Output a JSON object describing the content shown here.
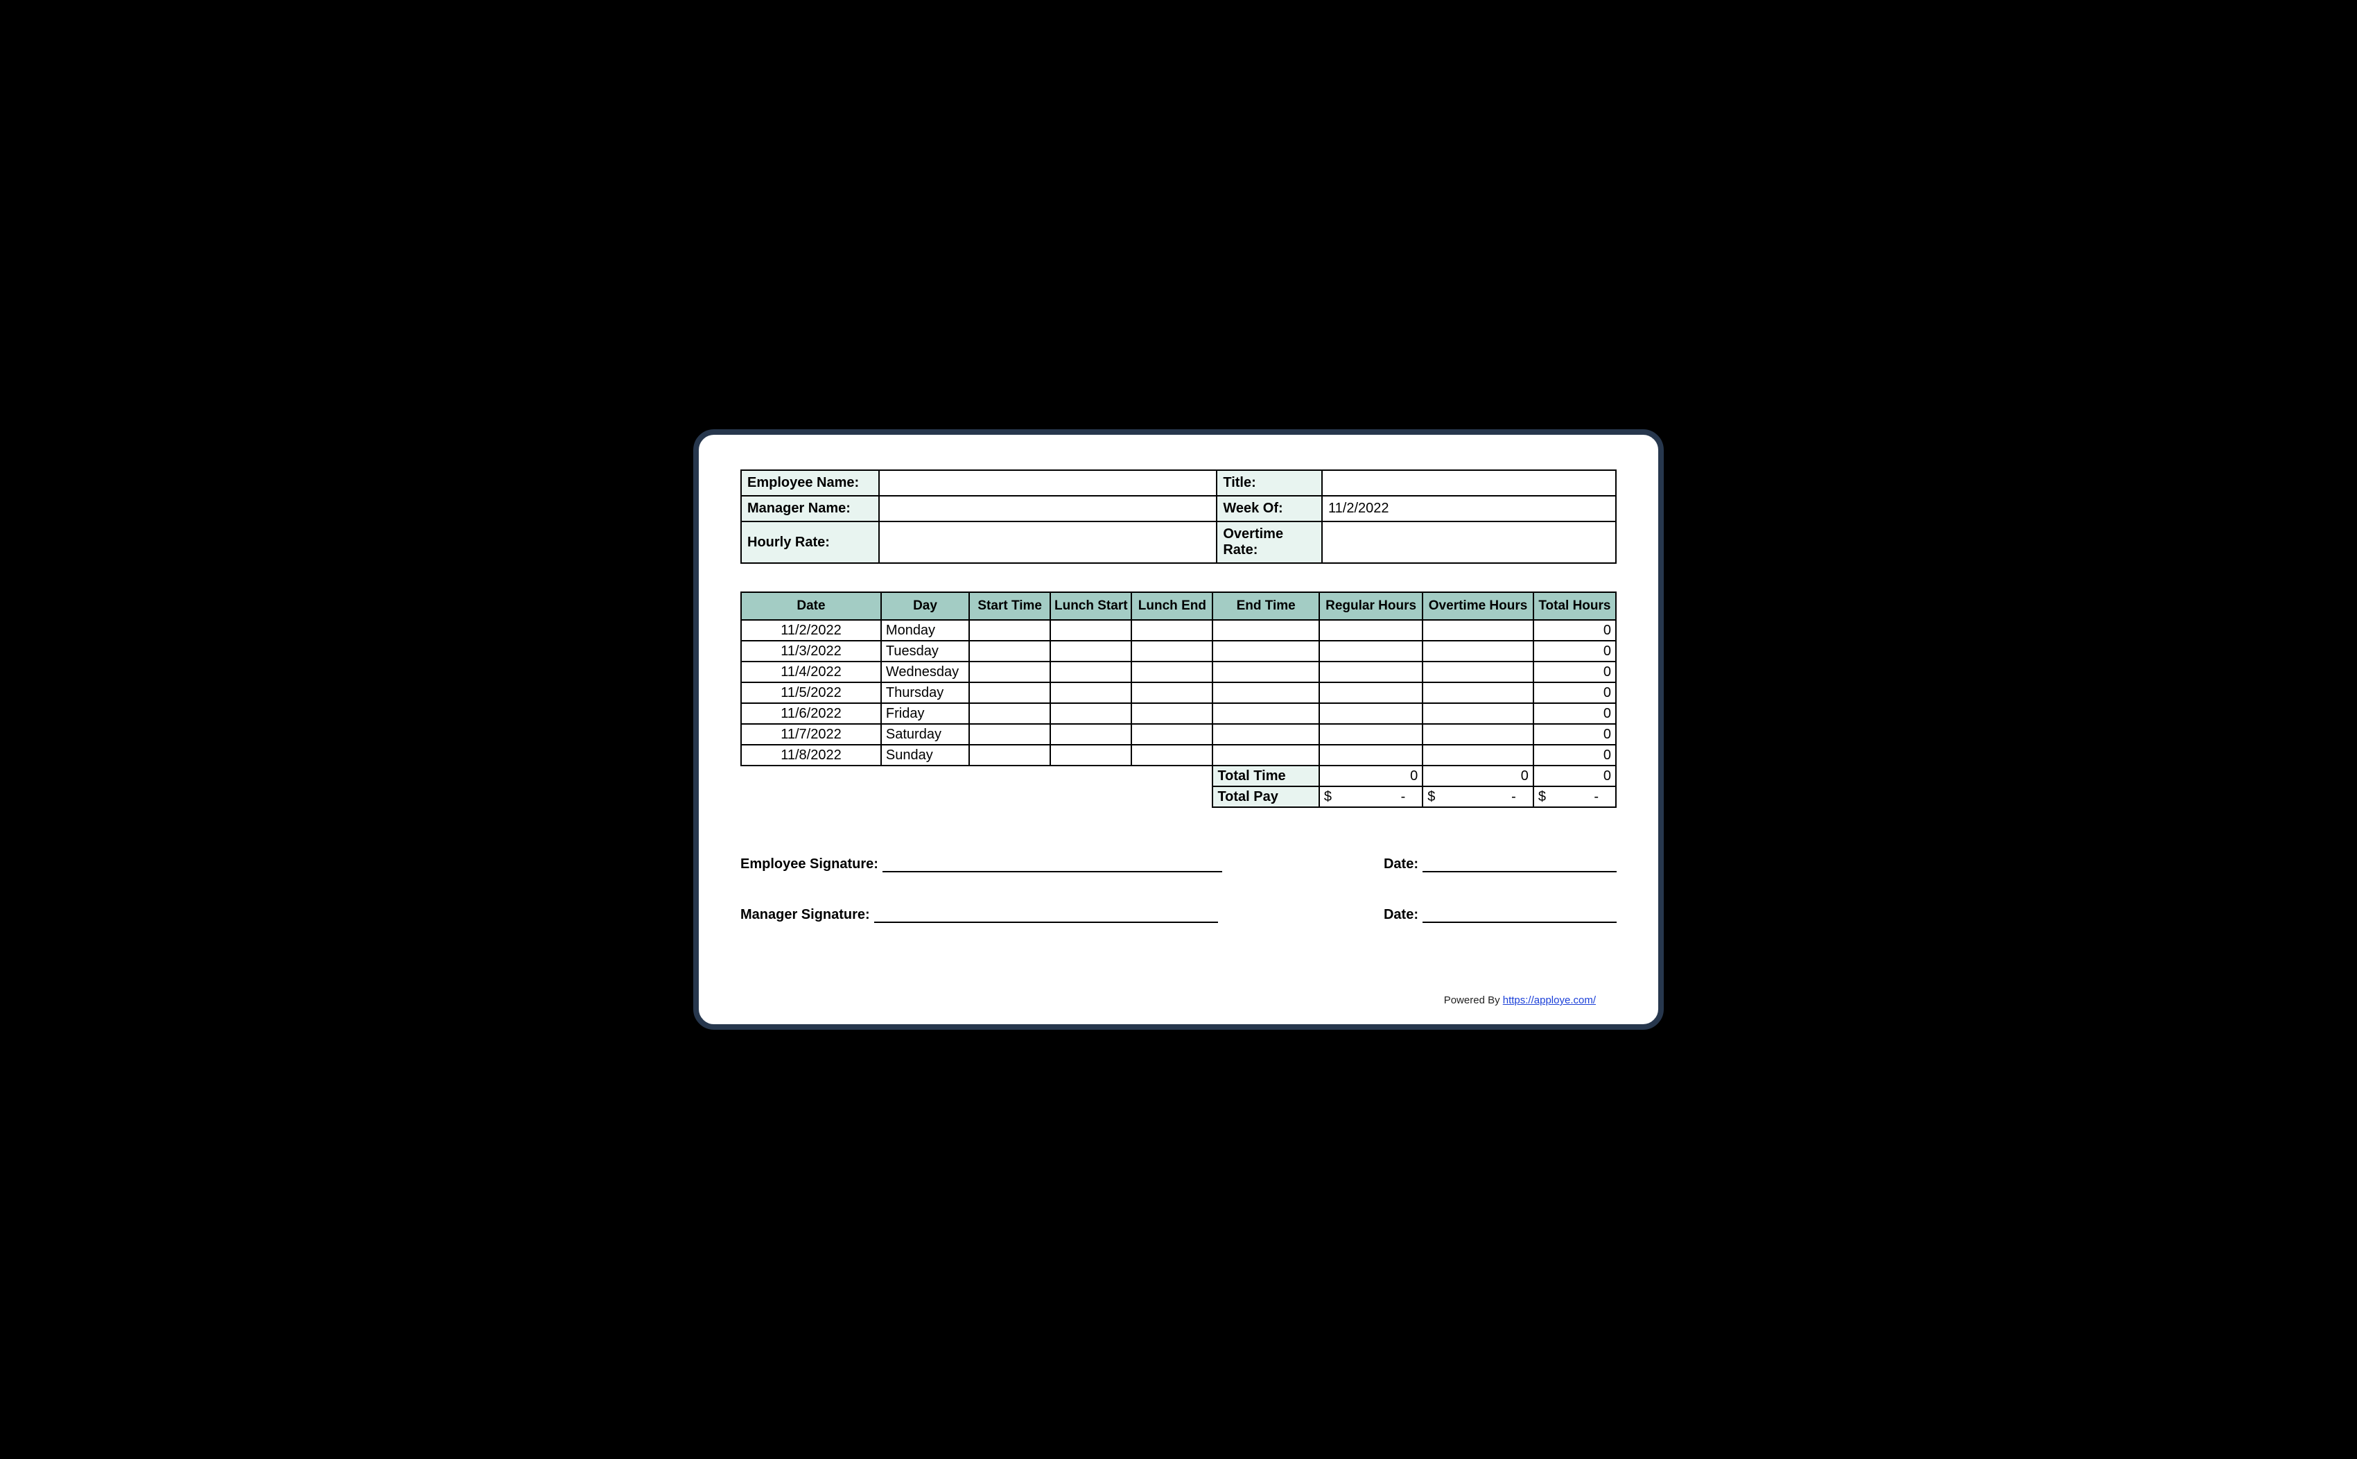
{
  "info": {
    "employee_name_label": "Employee Name:",
    "employee_name_value": "",
    "title_label": "Title:",
    "title_value": "",
    "manager_name_label": "Manager Name:",
    "manager_name_value": "",
    "week_of_label": "Week Of:",
    "week_of_value": "11/2/2022",
    "hourly_rate_label": "Hourly Rate:",
    "hourly_rate_value": "",
    "overtime_rate_label": "Overtime Rate:",
    "overtime_rate_value": ""
  },
  "headers": {
    "date": "Date",
    "day": "Day",
    "start_time": "Start Time",
    "lunch_start": "Lunch Start",
    "lunch_end": "Lunch End",
    "end_time": "End Time",
    "regular_hours": "Regular Hours",
    "overtime_hours": "Overtime Hours",
    "total_hours": "Total Hours"
  },
  "rows": [
    {
      "date": "11/2/2022",
      "day": "Monday",
      "start": "",
      "lstart": "",
      "lend": "",
      "end": "",
      "reg": "",
      "ot": "",
      "total": "0"
    },
    {
      "date": "11/3/2022",
      "day": "Tuesday",
      "start": "",
      "lstart": "",
      "lend": "",
      "end": "",
      "reg": "",
      "ot": "",
      "total": "0"
    },
    {
      "date": "11/4/2022",
      "day": "Wednesday",
      "start": "",
      "lstart": "",
      "lend": "",
      "end": "",
      "reg": "",
      "ot": "",
      "total": "0"
    },
    {
      "date": "11/5/2022",
      "day": "Thursday",
      "start": "",
      "lstart": "",
      "lend": "",
      "end": "",
      "reg": "",
      "ot": "",
      "total": "0"
    },
    {
      "date": "11/6/2022",
      "day": "Friday",
      "start": "",
      "lstart": "",
      "lend": "",
      "end": "",
      "reg": "",
      "ot": "",
      "total": "0"
    },
    {
      "date": "11/7/2022",
      "day": "Saturday",
      "start": "",
      "lstart": "",
      "lend": "",
      "end": "",
      "reg": "",
      "ot": "",
      "total": "0"
    },
    {
      "date": "11/8/2022",
      "day": "Sunday",
      "start": "",
      "lstart": "",
      "lend": "",
      "end": "",
      "reg": "",
      "ot": "",
      "total": "0"
    }
  ],
  "summary": {
    "total_time_label": "Total Time",
    "total_time_reg": "0",
    "total_time_ot": "0",
    "total_time_total": "0",
    "total_pay_label": "Total Pay",
    "pay_symbol": "$",
    "pay_dash": "-"
  },
  "signatures": {
    "employee_label": "Employee Signature:",
    "manager_label": "Manager Signature:",
    "date_label": "Date:"
  },
  "footer": {
    "powered_by": "Powered By ",
    "link_text": "https://apploye.com/"
  }
}
